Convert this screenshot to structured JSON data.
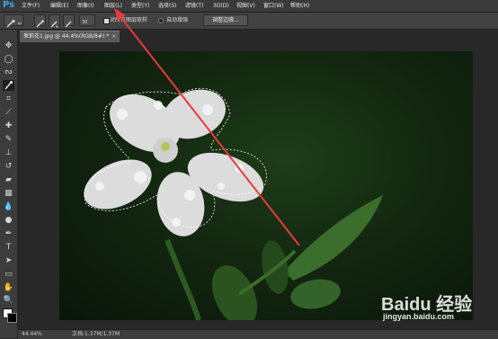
{
  "app": {
    "logo": "Ps"
  },
  "menubar": {
    "items": [
      {
        "label": "文件(F)"
      },
      {
        "label": "编辑(E)"
      },
      {
        "label": "图像(I)"
      },
      {
        "label": "图层(L)"
      },
      {
        "label": "类型(Y)"
      },
      {
        "label": "选择(S)"
      },
      {
        "label": "滤镜(T)"
      },
      {
        "label": "3D(D)"
      },
      {
        "label": "视图(V)"
      },
      {
        "label": "窗口(W)"
      },
      {
        "label": "帮助(H)"
      }
    ]
  },
  "options_bar": {
    "brush_size": "30",
    "sample_all_layers_label": "对所有图层取样",
    "sample_all_layers_checked": true,
    "auto_enhance_label": "自动增强",
    "auto_enhance_checked": false,
    "refine_edge_label": "调整边缘..."
  },
  "document_tab": {
    "title": "茉莉花1.jpg @ 44.4%(RGB/8#) *",
    "close_symbol": "×"
  },
  "status_bar": {
    "zoom": "44.44%",
    "doc_info": "文档:1.37M/1.37M"
  },
  "watermark": {
    "brand": "Baidu 经验",
    "url": "jingyan.baidu.com"
  },
  "icons": {
    "toolbar": [
      "move-tool-icon",
      "marquee-tool-icon",
      "lasso-tool-icon",
      "quick-selection-tool-icon",
      "crop-tool-icon",
      "eyedropper-tool-icon",
      "healing-brush-icon",
      "brush-tool-icon",
      "clone-stamp-icon",
      "history-brush-icon",
      "eraser-tool-icon",
      "gradient-tool-icon",
      "blur-tool-icon",
      "dodge-tool-icon",
      "pen-tool-icon",
      "type-tool-icon",
      "path-selection-icon",
      "rectangle-tool-icon",
      "hand-tool-icon",
      "zoom-tool-icon"
    ]
  },
  "colors": {
    "foreground": "#ffffff",
    "background": "#000000",
    "arrow": "#e83a3a"
  }
}
